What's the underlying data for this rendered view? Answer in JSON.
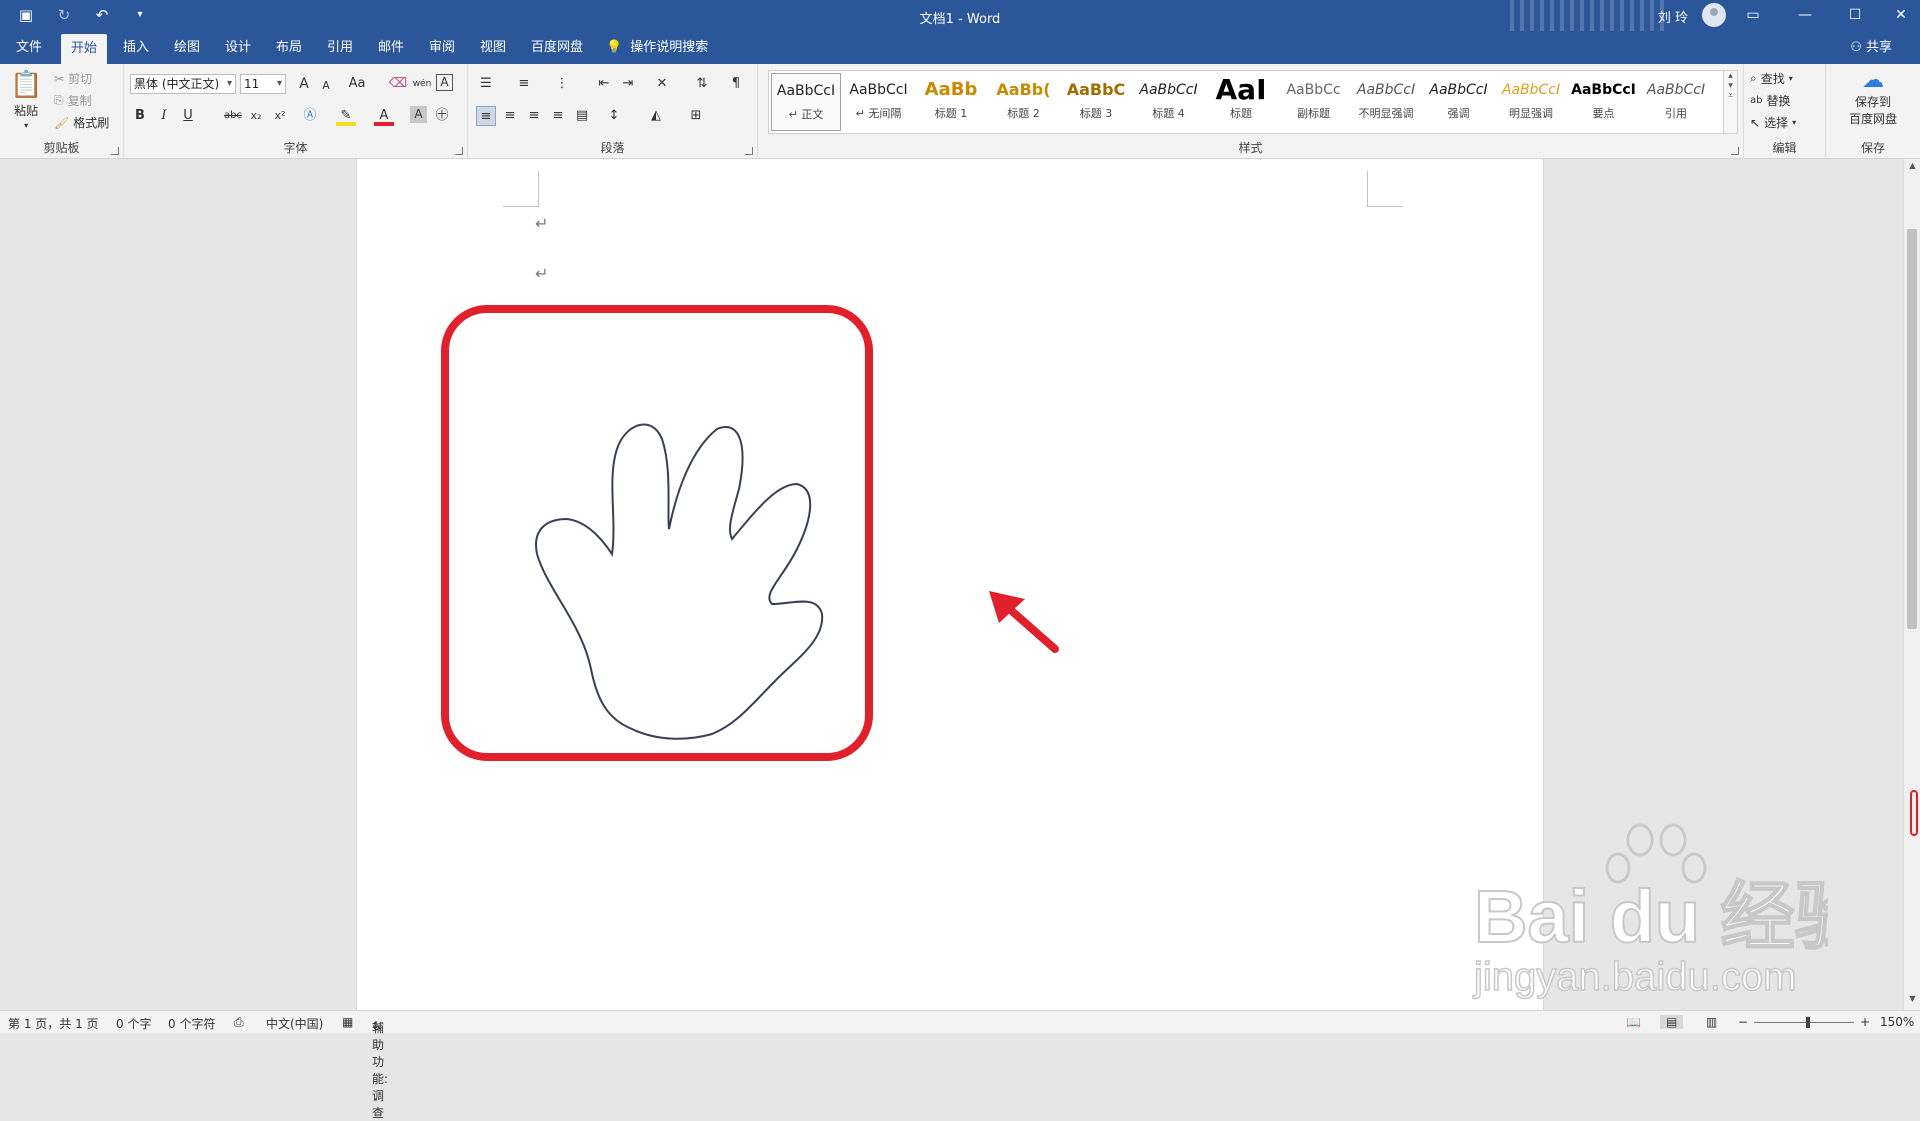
{
  "titlebar": {
    "doc_title": "文档1  -  Word",
    "user_name": "刘 玲",
    "min_symbol": "—",
    "max_symbol": "☐",
    "close_symbol": "✕",
    "ribbon_display_symbol": "▭"
  },
  "tabs": [
    "文件",
    "开始",
    "插入",
    "绘图",
    "设计",
    "布局",
    "引用",
    "邮件",
    "审阅",
    "视图",
    "百度网盘"
  ],
  "tell_me": "操作说明搜索",
  "share_label": "共享",
  "clipboard": {
    "paste": "粘贴",
    "cut": "剪切",
    "copy": "复制",
    "format_painter": "格式刷",
    "group_label": "剪贴板"
  },
  "font": {
    "name": "黑体 (中文正文)",
    "size": "11",
    "group_label": "字体",
    "grow": "A",
    "shrink": "A",
    "case": "Aa",
    "bold": "B",
    "italic": "I",
    "underline": "U",
    "strike": "abc",
    "sub": "x₂",
    "sup": "x²",
    "color_a": "A",
    "char_shading": "A",
    "wen": "wén",
    "border_a": "A"
  },
  "paragraph": {
    "group_label": "段落"
  },
  "styles": {
    "group_label": "样式",
    "items": [
      {
        "sample": "AaBbCcI",
        "name": "↵ 正文",
        "color": "#222222"
      },
      {
        "sample": "AaBbCcI",
        "name": "↵ 无间隔",
        "color": "#222222"
      },
      {
        "sample": "AaBb",
        "name": "标题 1",
        "color": "#c88a00"
      },
      {
        "sample": "AaBb(",
        "name": "标题 2",
        "color": "#c88a00"
      },
      {
        "sample": "AaBbC",
        "name": "标题 3",
        "color": "#a06d00"
      },
      {
        "sample": "AaBbCcI",
        "name": "标题 4",
        "color": "#222222"
      },
      {
        "sample": "AaI",
        "name": "标题",
        "color": "#000000"
      },
      {
        "sample": "AaBbCc",
        "name": "副标题",
        "color": "#666666"
      },
      {
        "sample": "AaBbCcI",
        "name": "不明显强调",
        "color": "#555555"
      },
      {
        "sample": "AaBbCcI",
        "name": "强调",
        "color": "#222222"
      },
      {
        "sample": "AaBbCcI",
        "name": "明显强调",
        "color": "#e0a020"
      },
      {
        "sample": "AaBbCcI",
        "name": "要点",
        "color": "#000000"
      },
      {
        "sample": "AaBbCcI",
        "name": "引用",
        "color": "#555555"
      }
    ]
  },
  "editing": {
    "find": "查找",
    "replace": "替换",
    "select": "选择",
    "group_label": "编辑"
  },
  "save_group": {
    "line1": "保存到",
    "line2": "百度网盘",
    "group_label": "保存"
  },
  "document": {
    "para_marks": [
      "↵",
      "↵"
    ],
    "accent_red": "#e0202a",
    "hand_stroke": "#3a3f55"
  },
  "statusbar": {
    "page": "第 1 页，共 1 页",
    "words": "0 个字",
    "chars": "0 个字符",
    "language": "中文(中国)",
    "accessibility": "辅助功能: 调查",
    "zoom": "150%",
    "zoom_minus": "−",
    "zoom_plus": "+"
  },
  "watermark": {
    "brand": "Bai  du 经验",
    "url": "jingyan.baidu.com"
  }
}
